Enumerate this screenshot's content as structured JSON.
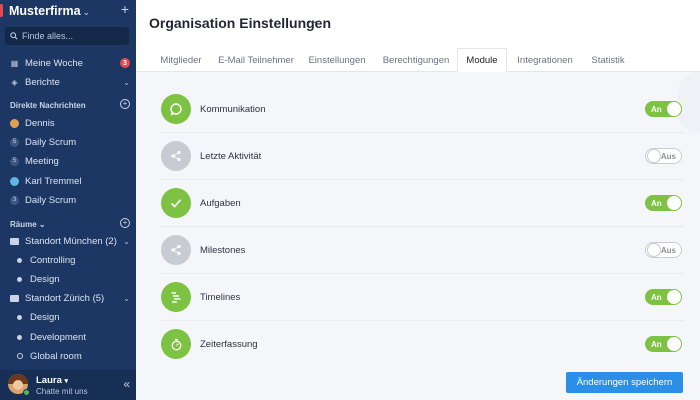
{
  "sidebar": {
    "brand": "Musterfirma",
    "search_placeholder": "Finde alles...",
    "nav": [
      {
        "label": "Meine Woche",
        "badge": "3"
      },
      {
        "label": "Berichte"
      }
    ],
    "dm_header": "Direkte Nachrichten",
    "dms": [
      {
        "label": "Dennis",
        "kind": "avatar"
      },
      {
        "label": "Daily Scrum",
        "kind": "count",
        "count": "5"
      },
      {
        "label": "Meeting",
        "kind": "count",
        "count": "5"
      },
      {
        "label": "Karl Tremmel",
        "kind": "avatar"
      },
      {
        "label": "Daily Scrum",
        "kind": "count",
        "count": "3"
      }
    ],
    "rooms_header": "Räume",
    "rooms": [
      {
        "label": "Standort München (2)",
        "type": "folder"
      },
      {
        "label": "Controlling",
        "type": "room"
      },
      {
        "label": "Design",
        "type": "room"
      },
      {
        "label": "Standort Zürich (5)",
        "type": "folder"
      },
      {
        "label": "Design",
        "type": "room"
      },
      {
        "label": "Development",
        "type": "room"
      },
      {
        "label": "Global room",
        "type": "room-open"
      }
    ],
    "user": {
      "name": "Laura",
      "status": "Chatte mit uns"
    }
  },
  "header": {
    "title": "Organisation Einstellungen",
    "more": "···"
  },
  "tabs": [
    {
      "label": "Mitglieder"
    },
    {
      "label": "E-Mail Teilnehmer"
    },
    {
      "label": "Einstellungen"
    },
    {
      "label": "Berechtigungen"
    },
    {
      "label": "Module",
      "active": true
    },
    {
      "label": "Integrationen"
    },
    {
      "label": "Statistik"
    }
  ],
  "modules": [
    {
      "label": "Kommunikation",
      "enabled": true,
      "toggle_text": "An",
      "icon": "chat-bubble-icon"
    },
    {
      "label": "Letzte Aktivität",
      "enabled": false,
      "toggle_text": "Aus",
      "icon": "share-icon"
    },
    {
      "label": "Aufgaben",
      "enabled": true,
      "toggle_text": "An",
      "icon": "checkmark-icon"
    },
    {
      "label": "Milestones",
      "enabled": false,
      "toggle_text": "Aus",
      "icon": "share-icon"
    },
    {
      "label": "Timelines",
      "enabled": true,
      "toggle_text": "An",
      "icon": "timeline-icon"
    },
    {
      "label": "Zeiterfassung",
      "enabled": true,
      "toggle_text": "An",
      "icon": "stopwatch-icon"
    }
  ],
  "save_button": "Änderungen speichern",
  "colors": {
    "sidebar": "#1c3763",
    "accent_green": "#7dc242",
    "primary_blue": "#2b8fe8",
    "badge_red": "#e5484d"
  }
}
